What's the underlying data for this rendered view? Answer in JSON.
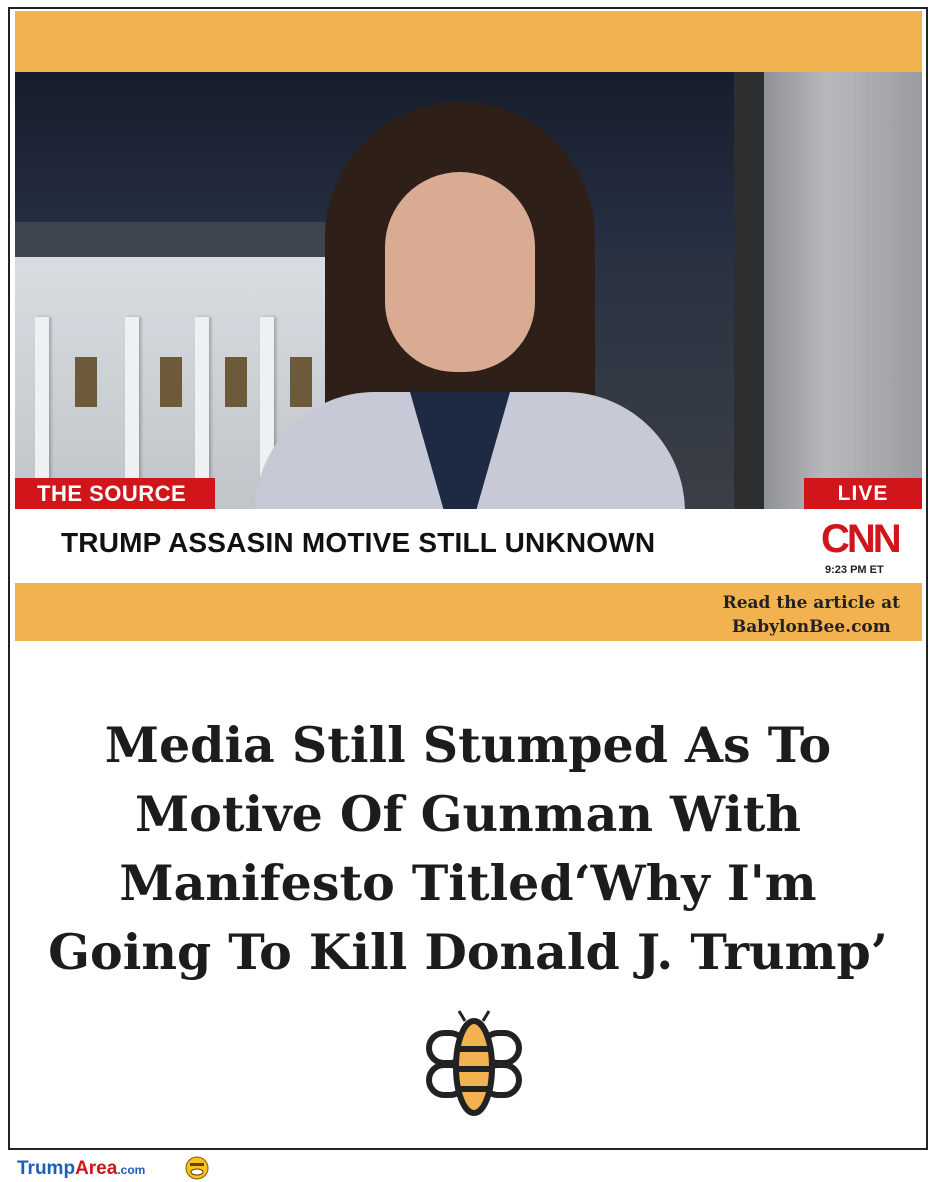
{
  "tv_segment": {
    "show_tag": "THE SOURCE",
    "live_tag": "LIVE",
    "headline": "TRUMP ASSASIN MOTIVE STILL UNKNOWN",
    "network_logo": "CNN",
    "time": "9:23 PM ET"
  },
  "credit": {
    "line1": "Read the article at",
    "line2": "BabylonBee.com"
  },
  "article": {
    "headline_lines": [
      "Media Still Stumped As To",
      "Motive Of Gunman With",
      "Manifesto Titled‘Why I'm",
      "Going To Kill Donald J. Trump’"
    ]
  },
  "logo": {
    "icon": "babylon-bee-icon"
  },
  "footer": {
    "brand_trump": "Trump",
    "brand_area": "Area",
    "brand_com": ".com",
    "icon": "smiley-emoji-icon"
  },
  "colors": {
    "band_orange": "#f2b250",
    "cnn_red": "#d0151b",
    "brand_blue": "#1d5fb3"
  }
}
